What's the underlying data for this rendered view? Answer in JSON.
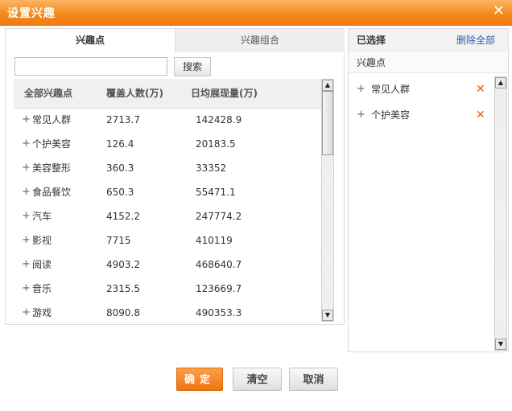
{
  "dialog": {
    "title": "设置兴趣",
    "close_glyph": "✕"
  },
  "tabs": [
    {
      "label": "兴趣点",
      "active": true
    },
    {
      "label": "兴趣组合",
      "active": false
    }
  ],
  "search": {
    "value": "",
    "placeholder": "",
    "button_label": "搜索"
  },
  "table": {
    "columns": [
      "全部兴趣点",
      "覆盖人数(万)",
      "日均展现量(万)"
    ],
    "rows": [
      {
        "name": "常见人群",
        "cover": "2713.7",
        "daily": "142428.9"
      },
      {
        "name": "个护美容",
        "cover": "126.4",
        "daily": "20183.5"
      },
      {
        "name": "美容整形",
        "cover": "360.3",
        "daily": "33352"
      },
      {
        "name": "食品餐饮",
        "cover": "650.3",
        "daily": "55471.1"
      },
      {
        "name": "汽车",
        "cover": "4152.2",
        "daily": "247774.2"
      },
      {
        "name": "影视",
        "cover": "7715",
        "daily": "410119"
      },
      {
        "name": "阅读",
        "cover": "4903.2",
        "daily": "468640.7"
      },
      {
        "name": "音乐",
        "cover": "2315.5",
        "daily": "123669.7"
      },
      {
        "name": "游戏",
        "cover": "8090.8",
        "daily": "490353.3"
      }
    ],
    "expand_glyph": "+"
  },
  "selected_panel": {
    "title": "已选择",
    "delete_all_label": "删除全部",
    "subheader": "兴趣点",
    "items": [
      {
        "name": "常见人群"
      },
      {
        "name": "个护美容"
      }
    ],
    "remove_glyph": "✕"
  },
  "footer": {
    "ok_label": "确定",
    "clear_label": "清空",
    "cancel_label": "取消"
  },
  "colors": {
    "accent": "#f58a1c",
    "remove": "#e85a1a",
    "link": "#2a5db0"
  }
}
